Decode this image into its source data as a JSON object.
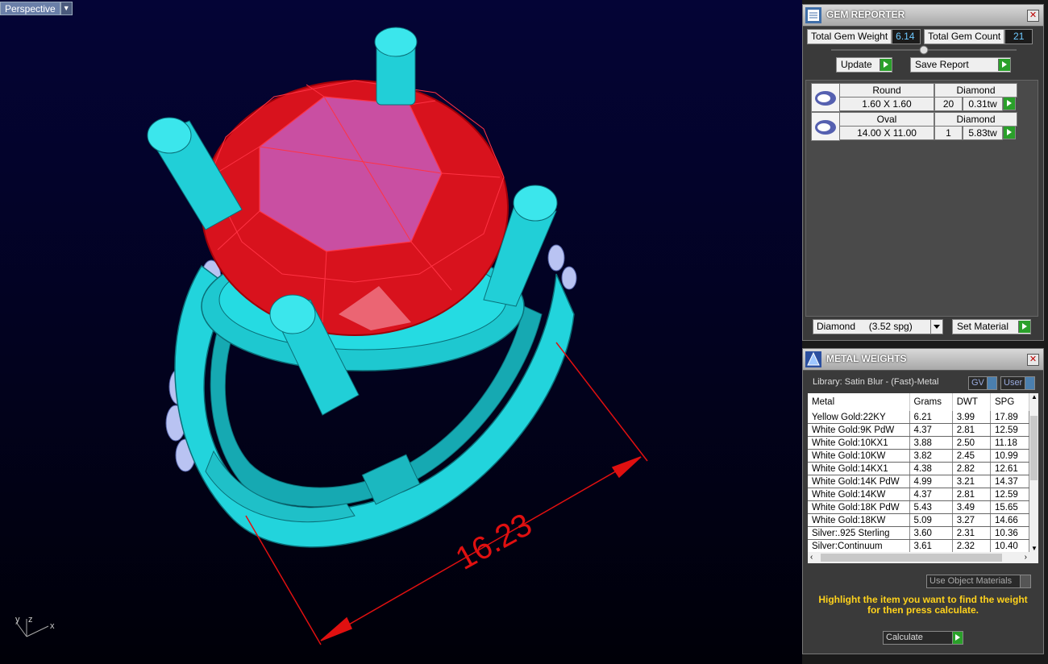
{
  "viewport": {
    "label": "Perspective",
    "dimension": "16.23",
    "axes": {
      "y": "y",
      "z": "z",
      "x": "x"
    },
    "colors": {
      "metal": "#2fe0e6",
      "stone": "#e0101a",
      "dimension": "#e01010",
      "background": "#04043a"
    }
  },
  "gem_reporter": {
    "title": "GEM REPORTER",
    "total_weight_label": "Total Gem Weight",
    "total_weight_value": "6.14",
    "total_count_label": "Total Gem Count",
    "total_count_value": "21",
    "update_label": "Update",
    "save_report_label": "Save Report",
    "gems": [
      {
        "shape": "Round",
        "type": "Diamond",
        "size": "1.60 X 1.60",
        "count": "20",
        "weight": "0.31tw"
      },
      {
        "shape": "Oval",
        "type": "Diamond",
        "size": "14.00 X 11.00",
        "count": "1",
        "weight": "5.83tw"
      }
    ],
    "material_select": "Diamond     (3.52 spg)",
    "set_material_label": "Set Material"
  },
  "metal_weights": {
    "title": "METAL WEIGHTS",
    "library": "Library: Satin Blur - (Fast)-Metal",
    "gv_label": "GV",
    "user_label": "User",
    "columns": [
      "Metal",
      "Grams",
      "DWT",
      "SPG"
    ],
    "rows": [
      {
        "metal": "Yellow Gold:22KY",
        "grams": "6.21",
        "dwt": "3.99",
        "spg": "17.89"
      },
      {
        "metal": "White Gold:9K PdW",
        "grams": "4.37",
        "dwt": "2.81",
        "spg": "12.59"
      },
      {
        "metal": "White Gold:10KX1",
        "grams": "3.88",
        "dwt": "2.50",
        "spg": "11.18"
      },
      {
        "metal": "White Gold:10KW",
        "grams": "3.82",
        "dwt": "2.45",
        "spg": "10.99"
      },
      {
        "metal": "White Gold:14KX1",
        "grams": "4.38",
        "dwt": "2.82",
        "spg": "12.61"
      },
      {
        "metal": "White Gold:14K PdW",
        "grams": "4.99",
        "dwt": "3.21",
        "spg": "14.37"
      },
      {
        "metal": "White Gold:14KW",
        "grams": "4.37",
        "dwt": "2.81",
        "spg": "12.59"
      },
      {
        "metal": "White Gold:18K PdW",
        "grams": "5.43",
        "dwt": "3.49",
        "spg": "15.65"
      },
      {
        "metal": "White Gold:18KW",
        "grams": "5.09",
        "dwt": "3.27",
        "spg": "14.66"
      },
      {
        "metal": "Silver:.925 Sterling",
        "grams": "3.60",
        "dwt": "2.31",
        "spg": "10.36"
      },
      {
        "metal": "Silver:Continuum",
        "grams": "3.61",
        "dwt": "2.32",
        "spg": "10.40"
      }
    ],
    "use_object_materials": "Use Object Materials",
    "hint": "Highlight the item you want to find the weight for then press calculate.",
    "calculate_label": "Calculate"
  }
}
